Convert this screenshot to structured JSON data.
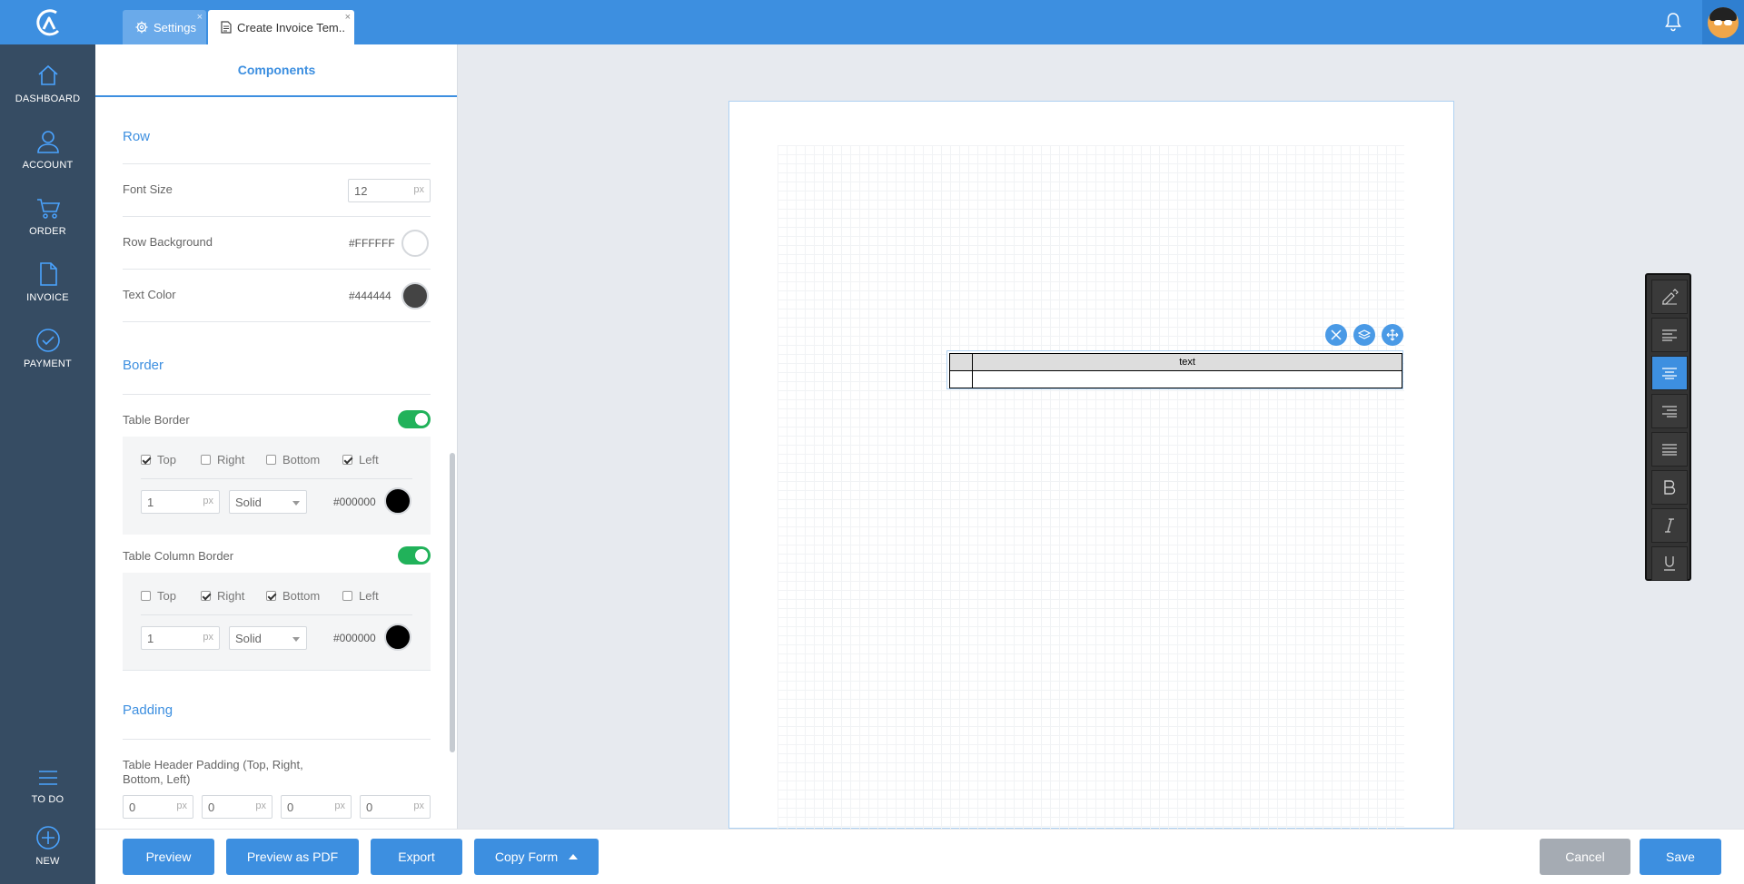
{
  "tabs": [
    {
      "label": "Settings",
      "icon": "gear-icon"
    },
    {
      "label": "Create Invoice Tem..",
      "icon": "document-icon"
    }
  ],
  "tab_close_glyph": "×",
  "nav": {
    "items": [
      {
        "label": "DASHBOARD",
        "icon": "home-icon"
      },
      {
        "label": "ACCOUNT",
        "icon": "user-icon"
      },
      {
        "label": "ORDER",
        "icon": "cart-icon"
      },
      {
        "label": "INVOICE",
        "icon": "document-icon"
      },
      {
        "label": "PAYMENT",
        "icon": "check-circle-icon"
      }
    ],
    "bottom": [
      {
        "label": "TO DO",
        "icon": "menu-icon"
      },
      {
        "label": "NEW",
        "icon": "plus-circle-icon"
      }
    ]
  },
  "panel": {
    "tab": "Components",
    "row": {
      "title": "Row",
      "font_size_label": "Font Size",
      "font_size_value": "12",
      "unit": "px",
      "background_label": "Row Background",
      "background_hex": "#FFFFFF",
      "text_color_label": "Text Color",
      "text_color_hex": "#444444"
    },
    "border": {
      "title": "Border",
      "table_border": {
        "label": "Table Border",
        "enabled": true,
        "checks": [
          {
            "label": "Top",
            "checked": true
          },
          {
            "label": "Right",
            "checked": false
          },
          {
            "label": "Bottom",
            "checked": false
          },
          {
            "label": "Left",
            "checked": true
          }
        ],
        "width": "1",
        "style": "Solid",
        "color_hex": "#000000"
      },
      "column_border": {
        "label": "Table Column Border",
        "enabled": true,
        "checks": [
          {
            "label": "Top",
            "checked": false
          },
          {
            "label": "Right",
            "checked": true
          },
          {
            "label": "Bottom",
            "checked": true
          },
          {
            "label": "Left",
            "checked": false
          }
        ],
        "width": "1",
        "style": "Solid",
        "color_hex": "#000000"
      }
    },
    "padding": {
      "title": "Padding",
      "header_label": "Table Header Padding (Top, Right, Bottom, Left)",
      "header_label_line1": "Table Header Padding (Top, Right,",
      "header_label_line2": "Bottom, Left)",
      "values": [
        "0",
        "0",
        "0",
        "0"
      ]
    }
  },
  "canvas": {
    "table": {
      "header": [
        "",
        "text"
      ],
      "rows": [
        [
          "",
          ""
        ]
      ]
    }
  },
  "format_toolbar": {
    "buttons": [
      "brush-icon",
      "align-left-icon",
      "align-center-icon",
      "align-right-icon",
      "align-justify-icon",
      "bold-icon",
      "italic-icon",
      "underline-icon"
    ],
    "active": "align-center-icon"
  },
  "footer": {
    "preview": "Preview",
    "preview_pdf": "Preview as PDF",
    "export": "Export",
    "copy_form": "Copy Form",
    "cancel": "Cancel",
    "save": "Save"
  },
  "colors": {
    "accent": "#3d8fe0",
    "nav_bg": "#364c63",
    "toggle_on": "#21b25a"
  }
}
